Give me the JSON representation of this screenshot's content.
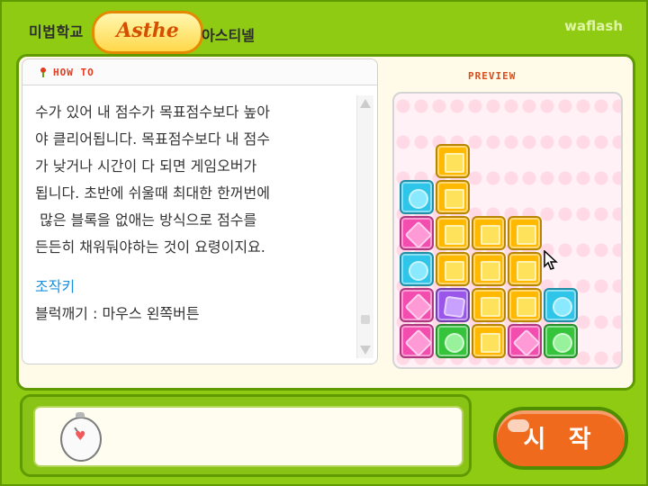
{
  "header": {
    "title": "미법학교",
    "logo_text": "Asthe",
    "subtitle": "아스티넬",
    "brand": "waflash"
  },
  "howto": {
    "title": "HOW TO",
    "description": "수가 있어 내 점수가 목표점수보다 높아\n야 클리어됩니다. 목표점수보다 내 점수\n가 낮거나 시간이 다 되면 게임오버가\n됩니다. 초반에 쉬울때 최대한 한꺼번에\n 많은 블록을 없애는 방식으로 점수를\n든든히 채워둬야하는 것이 요령이지요.",
    "controls_heading": "조작키",
    "controls_text": "블럭깨기 : 마우스 왼쪽버튼"
  },
  "preview": {
    "title": "PREVIEW",
    "tiles": [
      {
        "color": "yellow",
        "col": 1,
        "row": 0
      },
      {
        "color": "blue",
        "col": 0,
        "row": 1
      },
      {
        "color": "yellow",
        "col": 1,
        "row": 1
      },
      {
        "color": "pink",
        "col": 0,
        "row": 2
      },
      {
        "color": "yellow",
        "col": 1,
        "row": 2
      },
      {
        "color": "yellow",
        "col": 2,
        "row": 2
      },
      {
        "color": "yellow",
        "col": 3,
        "row": 2
      },
      {
        "color": "blue",
        "col": 0,
        "row": 3
      },
      {
        "color": "yellow",
        "col": 1,
        "row": 3
      },
      {
        "color": "yellow",
        "col": 2,
        "row": 3
      },
      {
        "color": "yellow",
        "col": 3,
        "row": 3
      },
      {
        "color": "pink",
        "col": 0,
        "row": 4
      },
      {
        "color": "purple",
        "col": 1,
        "row": 4
      },
      {
        "color": "yellow",
        "col": 2,
        "row": 4
      },
      {
        "color": "yellow",
        "col": 3,
        "row": 4
      },
      {
        "color": "blue",
        "col": 4,
        "row": 4
      },
      {
        "color": "pink",
        "col": 0,
        "row": 5
      },
      {
        "color": "green",
        "col": 1,
        "row": 5
      },
      {
        "color": "yellow",
        "col": 2,
        "row": 5
      },
      {
        "color": "pink",
        "col": 3,
        "row": 5
      },
      {
        "color": "green",
        "col": 4,
        "row": 5
      }
    ]
  },
  "controls": {
    "start_label": "시 작"
  }
}
